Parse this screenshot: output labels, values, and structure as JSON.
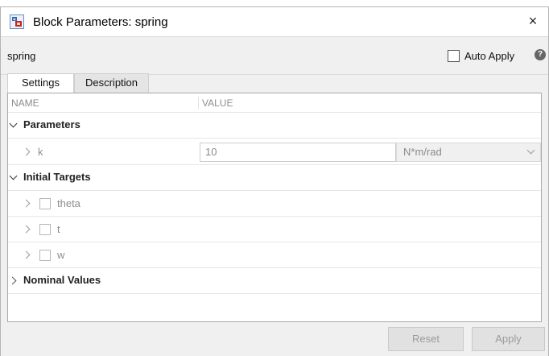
{
  "window": {
    "title": "Block Parameters: spring",
    "close_glyph": "×",
    "icon": "simulink-block-icon"
  },
  "blockbar": {
    "block_name": "spring",
    "auto_apply_label": "Auto Apply",
    "auto_apply_checked": false,
    "help_glyph": "?"
  },
  "tabs": [
    {
      "label": "Settings",
      "active": true
    },
    {
      "label": "Description",
      "active": false
    }
  ],
  "table": {
    "col_name": "NAME",
    "col_value": "VALUE",
    "sections": {
      "parameters": {
        "label": "Parameters",
        "expanded": true,
        "rows": [
          {
            "name": "k",
            "value": "10",
            "unit": "N*m/rad"
          }
        ]
      },
      "initial_targets": {
        "label": "Initial Targets",
        "expanded": true,
        "rows": [
          {
            "name": "theta",
            "checked": false
          },
          {
            "name": "t",
            "checked": false
          },
          {
            "name": "w",
            "checked": false
          }
        ]
      },
      "nominal_values": {
        "label": "Nominal Values",
        "expanded": false
      }
    }
  },
  "footer": {
    "reset_label": "Reset",
    "apply_label": "Apply"
  },
  "colors": {
    "accent_icon_red": "#c8281c",
    "accent_icon_blue": "#2d6db5",
    "disabled_text": "#9b9b9b"
  }
}
